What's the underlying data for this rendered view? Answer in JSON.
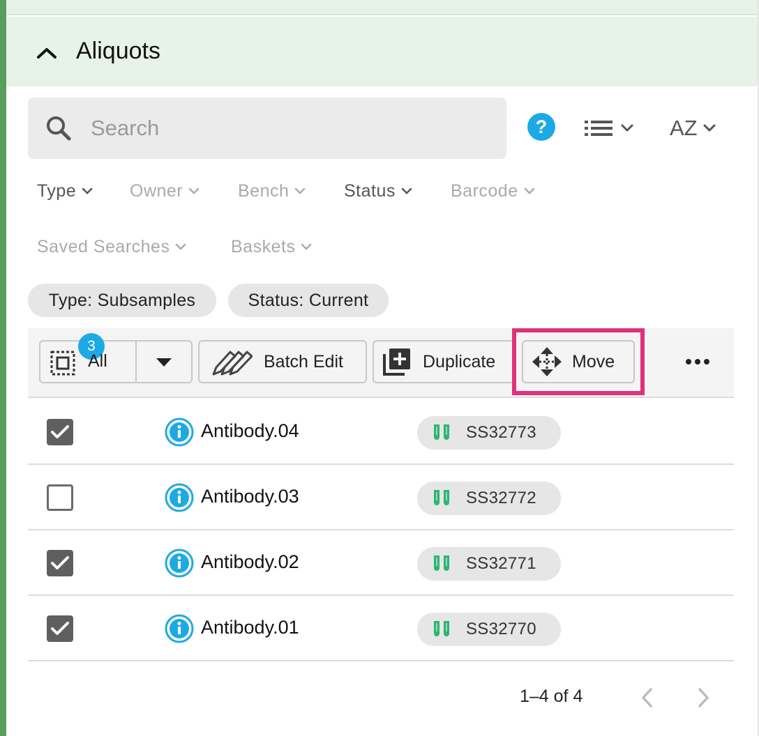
{
  "section": {
    "title": "Aliquots"
  },
  "search": {
    "placeholder": "Search"
  },
  "sort": {
    "label": "AZ"
  },
  "filters": [
    {
      "label": "Type",
      "active": true
    },
    {
      "label": "Owner",
      "active": false
    },
    {
      "label": "Bench",
      "active": false
    },
    {
      "label": "Status",
      "active": true
    },
    {
      "label": "Barcode",
      "active": false
    },
    {
      "label": "Saved Searches",
      "active": false
    },
    {
      "label": "Baskets",
      "active": false
    }
  ],
  "chips": [
    {
      "label": "Type: Subsamples"
    },
    {
      "label": "Status: Current"
    }
  ],
  "toolbar": {
    "selected_count": "3",
    "all_label": "All",
    "batch_edit_label": "Batch Edit",
    "duplicate_label": "Duplicate",
    "move_label": "Move"
  },
  "rows": [
    {
      "name": "Antibody.04",
      "id": "SS32773",
      "checked": true
    },
    {
      "name": "Antibody.03",
      "id": "SS32772",
      "checked": false
    },
    {
      "name": "Antibody.02",
      "id": "SS32771",
      "checked": true
    },
    {
      "name": "Antibody.01",
      "id": "SS32770",
      "checked": true
    }
  ],
  "pagination": {
    "text": "1–4 of 4"
  },
  "colors": {
    "accent": "#1da9e6",
    "header_bg": "#e8f3e8",
    "highlight": "#e0317a",
    "tube_green": "#2bb673",
    "left_bar": "#5a9e5e"
  }
}
